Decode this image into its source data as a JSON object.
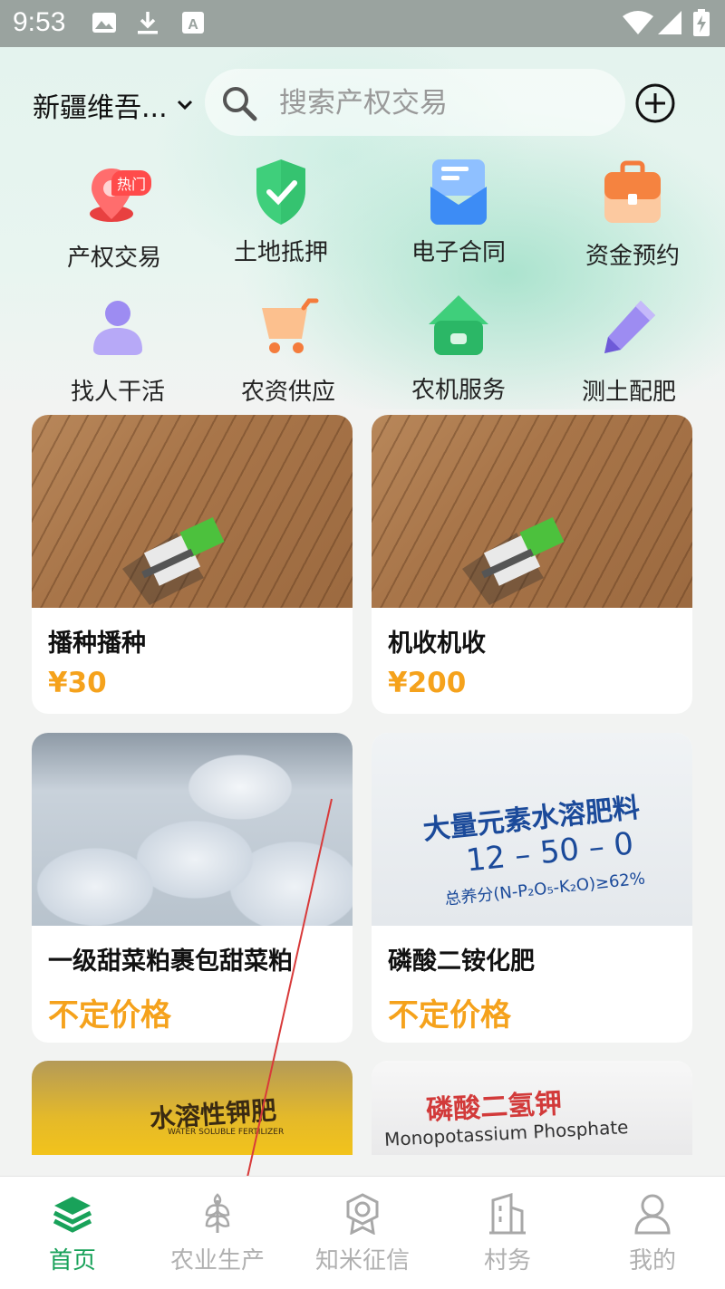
{
  "status_bar": {
    "time": "9:53"
  },
  "header": {
    "region": "新疆维吾...",
    "search_placeholder": "搜索产权交易"
  },
  "quick_actions": [
    {
      "label": "产权交易",
      "badge": "热门"
    },
    {
      "label": "土地抵押"
    },
    {
      "label": "电子合同"
    },
    {
      "label": "资金预约"
    },
    {
      "label": "找人干活"
    },
    {
      "label": "农资供应"
    },
    {
      "label": "农机服务"
    },
    {
      "label": "测土配肥"
    }
  ],
  "products": [
    {
      "title": "播种播种",
      "price": "¥30"
    },
    {
      "title": "机收机收",
      "price": "¥200"
    },
    {
      "title": "一级甜菜粕裹包甜菜粕",
      "price": "不定价格"
    },
    {
      "title": "磷酸二铵化肥",
      "price": "不定价格"
    },
    {
      "image_text": "水溶性钾肥",
      "image_subtext": "WATER SOLUBLE FERTILIZER"
    },
    {
      "image_text": "磷酸二氢钾",
      "image_subtext": "Monopotassium Phosphate"
    }
  ],
  "fertilizer_bag": {
    "line1": "大量元素水溶肥料",
    "line2": "12 – 50 – 0",
    "line3": "总养分(N-P₂O₅-K₂O)≥62%"
  },
  "tabs": [
    {
      "label": "首页"
    },
    {
      "label": "农业生产"
    },
    {
      "label": "知米征信"
    },
    {
      "label": "村务"
    },
    {
      "label": "我的"
    }
  ],
  "colors": {
    "accent": "#19a25a",
    "price": "#f5a21c",
    "badge": "#ff4b4b"
  }
}
